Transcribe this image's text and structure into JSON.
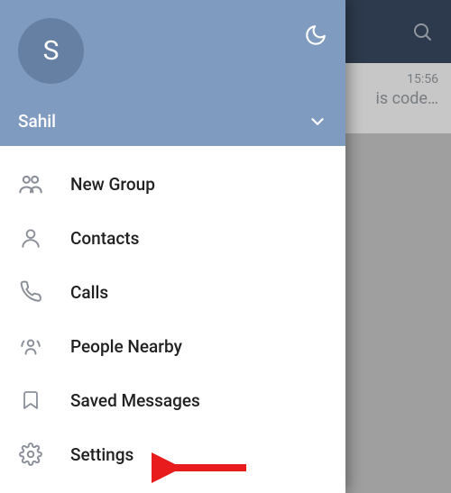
{
  "header": {
    "avatar_initial": "S",
    "username": "Sahil"
  },
  "menu": {
    "items": [
      {
        "label": "New Group"
      },
      {
        "label": "Contacts"
      },
      {
        "label": "Calls"
      },
      {
        "label": "People Nearby"
      },
      {
        "label": "Saved Messages"
      },
      {
        "label": "Settings"
      }
    ]
  },
  "backdrop": {
    "time": "15:56",
    "message_preview": "is code…"
  }
}
